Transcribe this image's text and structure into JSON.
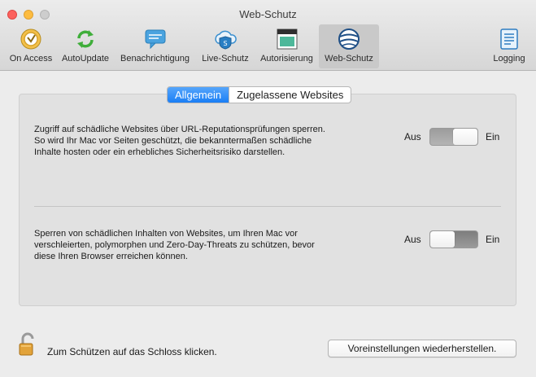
{
  "window": {
    "title": "Web-Schutz"
  },
  "toolbar": {
    "items": [
      {
        "label": "On Access",
        "icon": "on-access-icon"
      },
      {
        "label": "AutoUpdate",
        "icon": "autoupdate-icon"
      },
      {
        "label": "Benachrichtigung",
        "icon": "notification-icon"
      },
      {
        "label": "Live-Schutz",
        "icon": "live-protection-icon"
      },
      {
        "label": "Autorisierung",
        "icon": "authorization-icon"
      },
      {
        "label": "Web-Schutz",
        "icon": "web-protection-icon",
        "selected": true
      },
      {
        "label": "Logging",
        "icon": "logging-icon"
      }
    ]
  },
  "tabs": [
    {
      "label": "Allgemein",
      "active": true
    },
    {
      "label": "Zugelassene Websites",
      "active": false
    }
  ],
  "settings": [
    {
      "description": "Zugriff auf schädliche Websites über URL-Reputationsprüfungen sperren. So wird Ihr Mac vor Seiten geschützt, die bekanntermaßen schädliche Inhalte hosten oder ein erhebliches Sicherheitsrisiko darstellen.",
      "off_label": "Aus",
      "on_label": "Ein",
      "state": "on"
    },
    {
      "description": "Sperren von schädlichen Inhalten von Websites, um Ihren Mac vor verschleierten, polymorphen und Zero-Day-Threats zu schützen, bevor diese Ihren Browser erreichen können.",
      "off_label": "Aus",
      "on_label": "Ein",
      "state": "off"
    }
  ],
  "footer": {
    "lock_text": "Zum Schützen auf das Schloss klicken.",
    "restore_button": "Voreinstellungen wiederherstellen."
  },
  "colors": {
    "accent": "#1a7ef5",
    "close": "#fc615d",
    "minimize": "#fdbc40",
    "zoom": "#cdcdcd"
  }
}
